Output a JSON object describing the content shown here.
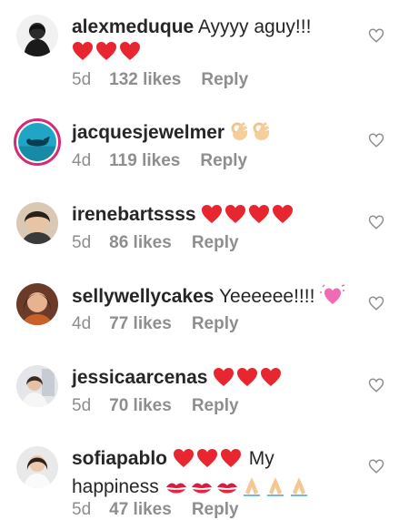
{
  "comments": [
    {
      "username": "alexmeduque",
      "text": "Ayyyy aguy!!!",
      "emojis": [
        "red-heart",
        "red-heart",
        "red-heart"
      ],
      "age": "5d",
      "likes": "132 likes",
      "reply": "Reply"
    },
    {
      "username": "jacquesjewelmer",
      "text": "",
      "emojis": [
        "ok-hand",
        "ok-hand"
      ],
      "age": "4d",
      "likes": "119 likes",
      "reply": "Reply"
    },
    {
      "username": "irenebartssss",
      "text": "",
      "emojis": [
        "red-heart",
        "red-heart",
        "red-heart",
        "red-heart"
      ],
      "age": "5d",
      "likes": "86 likes",
      "reply": "Reply"
    },
    {
      "username": "sellywellycakes",
      "text": "Yeeeeee!!!!",
      "emojis": [
        "sparkling-heart"
      ],
      "age": "4d",
      "likes": "77 likes",
      "reply": "Reply"
    },
    {
      "username": "jessicaarcenas",
      "text": "",
      "emojis": [
        "red-heart",
        "red-heart",
        "red-heart"
      ],
      "age": "5d",
      "likes": "70 likes",
      "reply": "Reply"
    },
    {
      "username": "sofiapablo",
      "text": "My happiness",
      "emojis": [
        "red-heart",
        "red-heart",
        "red-heart",
        "kiss-mark",
        "kiss-mark",
        "kiss-mark",
        "folded-hands",
        "folded-hands",
        "folded-hands"
      ],
      "age": "5d",
      "likes": "47 likes",
      "reply": "Reply"
    }
  ],
  "colors": {
    "username": "#262626",
    "meta": "#8e8e8e",
    "heart_outline": "#8e8e8e",
    "emoji_red": "#e8262f",
    "story_ring": "#d62976"
  }
}
